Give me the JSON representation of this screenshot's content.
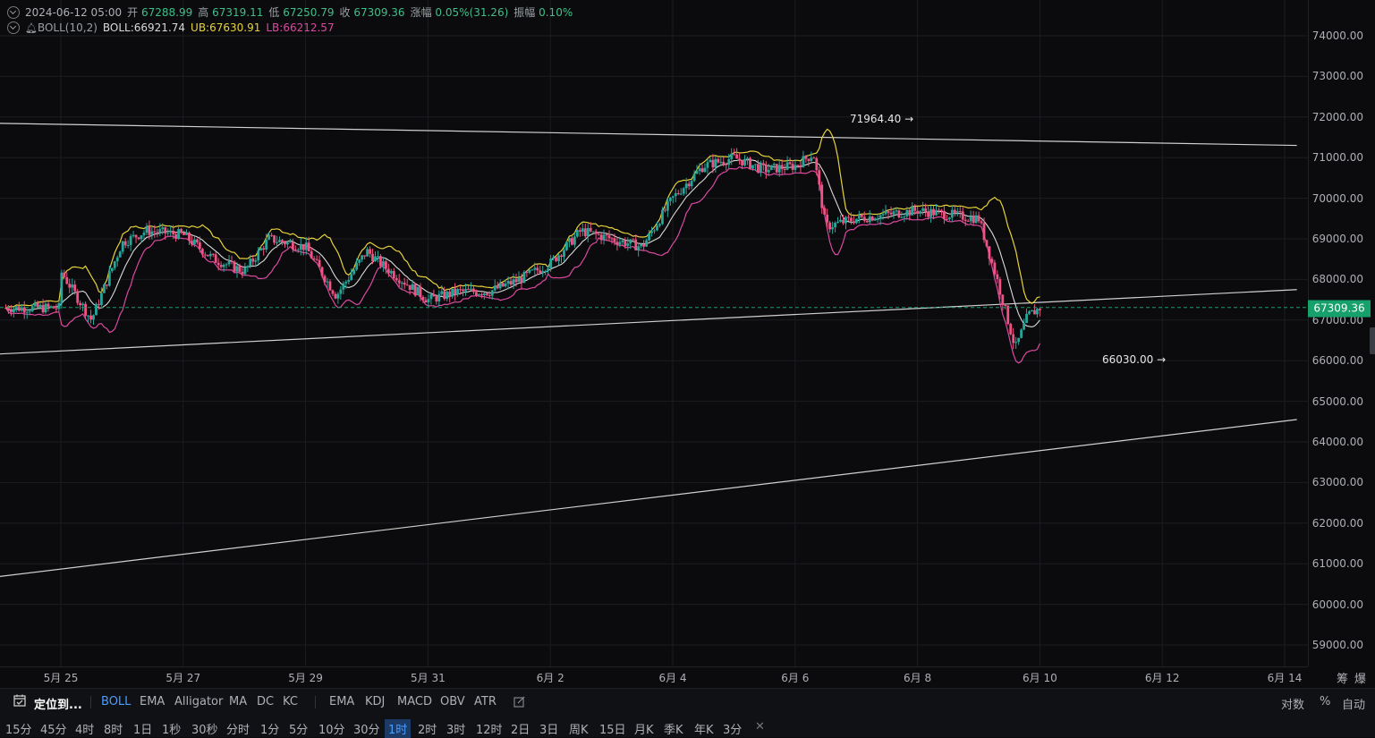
{
  "legend": {
    "date": "2024-06-12 05:00",
    "open_label": "开",
    "open": "67288.99",
    "high_label": "高",
    "high": "67319.11",
    "low_label": "低",
    "low": "67250.79",
    "close_label": "收",
    "close": "67309.36",
    "change_label": "涨幅",
    "change": "0.05%(31.26)",
    "amp_label": "振幅",
    "amp": "0.10%",
    "indicator": "BOLL(10,2)",
    "boll": "BOLL:66921.74",
    "ub": "UB:67630.91",
    "lb": "LB:66212.57"
  },
  "price_tag": "67309.36",
  "annotations": {
    "high": "71964.40 →",
    "low": "66030.00 →"
  },
  "price_axis": [
    "74000.00",
    "73000.00",
    "72000.00",
    "71000.00",
    "70000.00",
    "69000.00",
    "68000.00",
    "67000.00",
    "66000.00",
    "65000.00",
    "64000.00",
    "63000.00",
    "62000.00",
    "61000.00",
    "60000.00",
    "59000.00"
  ],
  "time_axis": [
    "5月 25",
    "5月 27",
    "5月 29",
    "5月 31",
    "6月 2",
    "6月 4",
    "6月 6",
    "6月 8",
    "6月 10",
    "6月 12",
    "6月 14"
  ],
  "axis_corner": [
    "筹",
    "爆"
  ],
  "toolbar": {
    "locate": "定位到...",
    "indicators": [
      "BOLL",
      "EMA",
      "Alligator",
      "MA",
      "DC",
      "KC"
    ],
    "sub_indicators": [
      "EMA",
      "KDJ",
      "MACD",
      "OBV",
      "ATR"
    ],
    "right": [
      "对数",
      "%",
      "自动"
    ]
  },
  "intervals": [
    "15分",
    "45分",
    "4时",
    "8时",
    "1日",
    "1秒",
    "30秒",
    "分时",
    "1分",
    "5分",
    "10分",
    "30分",
    "1时",
    "2时",
    "3时",
    "12时",
    "2日",
    "3日",
    "周K",
    "15日",
    "月K",
    "季K",
    "年K",
    "3分"
  ],
  "active_interval": "1时",
  "colors": {
    "up": "#26a69a",
    "down": "#ef5383",
    "mid": "#d9d9d9",
    "ub": "#e6d23a",
    "lb": "#d94aa0",
    "tag": "#16a06c"
  },
  "chart_data": {
    "type": "candlestick",
    "y_ticks": [
      74000,
      73000,
      72000,
      71000,
      70000,
      69000,
      68000,
      67000,
      66000,
      65000,
      64000,
      63000,
      62000,
      61000,
      60000,
      59000
    ],
    "ylim": [
      58500,
      74500
    ],
    "x_ticks": [
      "5月 25",
      "5月 27",
      "5月 29",
      "5月 31",
      "6月 2",
      "6月 4",
      "6月 6",
      "6月 8",
      "6月 10",
      "6月 12",
      "6月 14"
    ],
    "last_price": 67309.36,
    "high_mark": 71964.4,
    "low_mark": 66030.0,
    "close_path": [
      [
        0,
        68200
      ],
      [
        0.5,
        67000
      ],
      [
        1,
        68900
      ],
      [
        1.4,
        69200
      ],
      [
        2,
        69100
      ],
      [
        2.5,
        68500
      ],
      [
        3,
        68200
      ],
      [
        3.4,
        69000
      ],
      [
        4,
        68800
      ],
      [
        4.5,
        67600
      ],
      [
        5,
        68700
      ],
      [
        5.3,
        68300
      ],
      [
        6,
        67500
      ],
      [
        6.5,
        67700
      ],
      [
        7,
        67700
      ],
      [
        7.5,
        68000
      ],
      [
        8,
        68400
      ],
      [
        8.5,
        69200
      ],
      [
        9,
        69000
      ],
      [
        9.5,
        68800
      ],
      [
        10,
        70000
      ],
      [
        10.5,
        70800
      ],
      [
        11,
        71000
      ],
      [
        11.5,
        70700
      ],
      [
        12,
        70800
      ],
      [
        12.3,
        71100
      ],
      [
        12.5,
        69300
      ],
      [
        13,
        69500
      ],
      [
        14,
        69700
      ],
      [
        14.5,
        69600
      ],
      [
        15,
        69500
      ],
      [
        15.3,
        68000
      ],
      [
        15.6,
        66300
      ],
      [
        15.8,
        67100
      ],
      [
        16,
        67300
      ]
    ],
    "trend_lines": [
      {
        "name": "resistance",
        "from": [
          -1.2,
          71850
        ],
        "to": [
          20.2,
          71300
        ]
      },
      {
        "name": "support",
        "from": [
          -1.2,
          66150
        ],
        "to": [
          20.2,
          67750
        ]
      },
      {
        "name": "lower-support",
        "from": [
          -1.2,
          60650
        ],
        "to": [
          20.2,
          64550
        ]
      }
    ]
  }
}
